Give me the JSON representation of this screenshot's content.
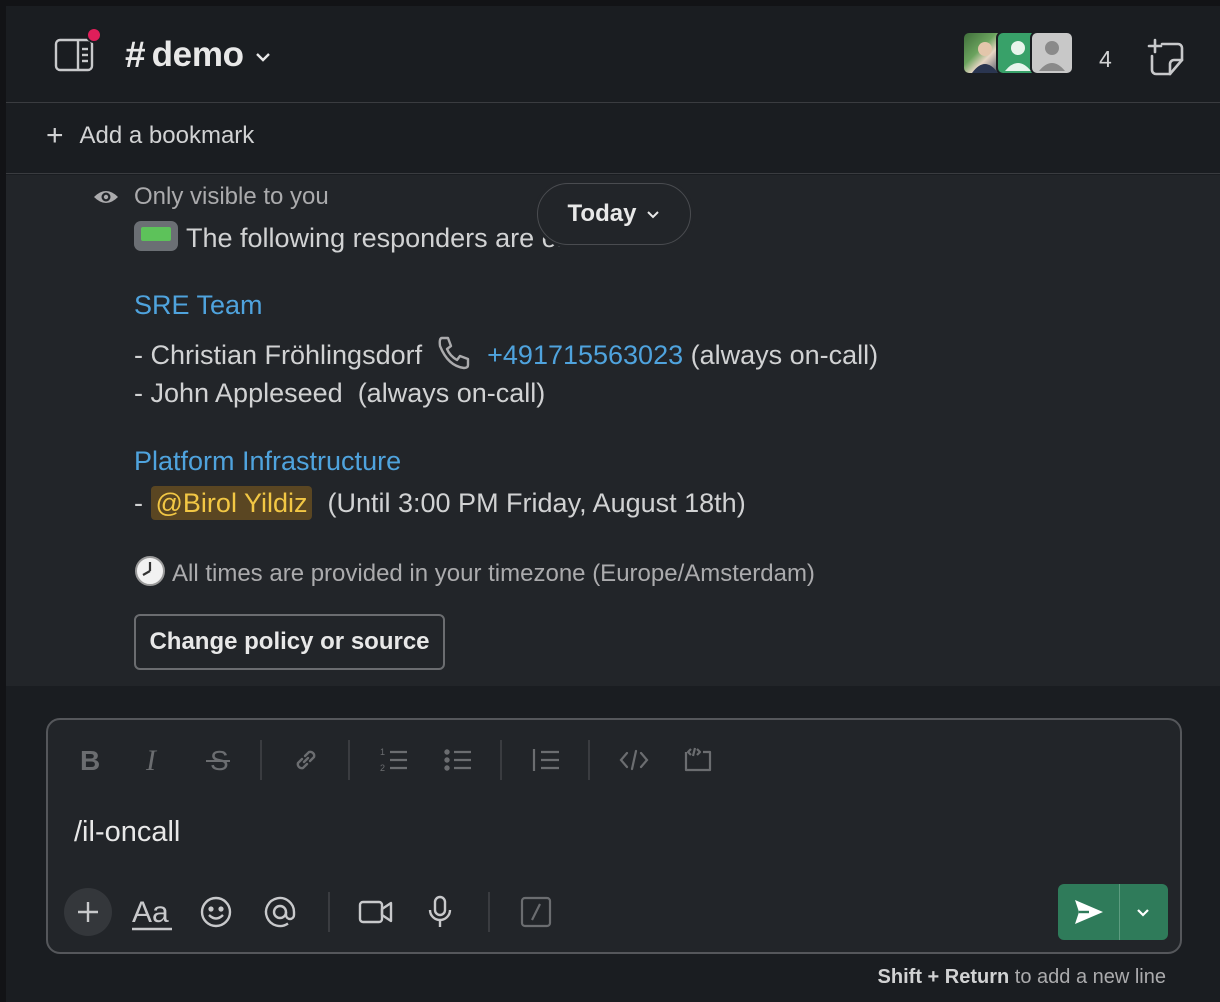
{
  "header": {
    "hash": "#",
    "channel": "demo",
    "member_count": "4",
    "avatars": [
      "avatar-photo",
      "avatar-green-default",
      "avatar-gray-default"
    ]
  },
  "bookmarks": {
    "add_label": "Add a bookmark"
  },
  "messages": {
    "visibility_note": "Only visible to you",
    "date_divider": "Today",
    "intro": "The following responders are on call:",
    "teams": [
      {
        "name": "SRE Team",
        "lines": [
          {
            "prefix": "- Christian Fröhlingsdorf",
            "phone": "+491715563023",
            "suffix": "(always on-call)"
          },
          {
            "prefix": "- John Appleseed",
            "suffix": "(always on-call)"
          }
        ]
      },
      {
        "name": "Platform Infrastructure",
        "lines": [
          {
            "prefix": "-",
            "mention": "@Birol Yildiz",
            "suffix": "(Until 3:00 PM Friday, August 18th)"
          }
        ]
      }
    ],
    "timezone_note": "All times are provided in your timezone (Europe/Amsterdam)",
    "action_button": "Change policy or source"
  },
  "composer": {
    "value": "/il-oncall",
    "hint_bold": "Shift + Return",
    "hint_rest": " to add a new line"
  },
  "colors": {
    "link": "#4fa3dd",
    "mention_bg": "#5a4622",
    "mention_fg": "#f2c744",
    "send": "#2f7b5a",
    "notification": "#e01e5a"
  }
}
